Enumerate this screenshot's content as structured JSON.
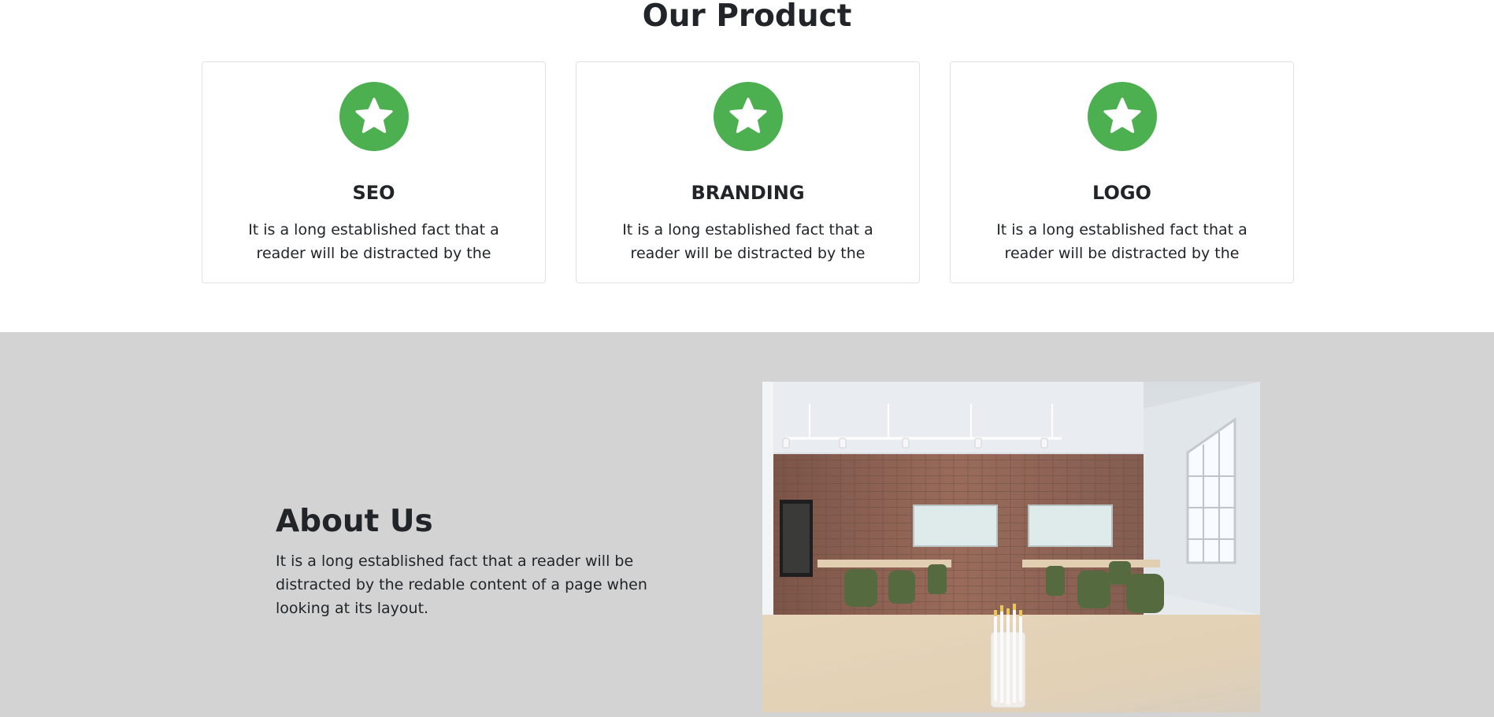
{
  "product": {
    "title": "Our Product",
    "cards": [
      {
        "icon": "star-icon",
        "title": "SEO",
        "text": "It is a long established fact that a reader will be distracted by the"
      },
      {
        "icon": "star-icon",
        "title": "BRANDING",
        "text": "It is a long established fact that a reader will be distracted by the"
      },
      {
        "icon": "star-icon",
        "title": "LOGO",
        "text": "It is a long established fact that a reader will be distracted by the"
      }
    ]
  },
  "about": {
    "title": "About Us",
    "text": "It is a long established fact that a reader will be distracted by the redable content of a page when looking at its layout.",
    "image": "office-meeting-room-photo"
  },
  "colors": {
    "accent": "#4caf50",
    "about_background": "#d3d3d3",
    "text": "#212529",
    "card_border": "#dee2e6"
  }
}
